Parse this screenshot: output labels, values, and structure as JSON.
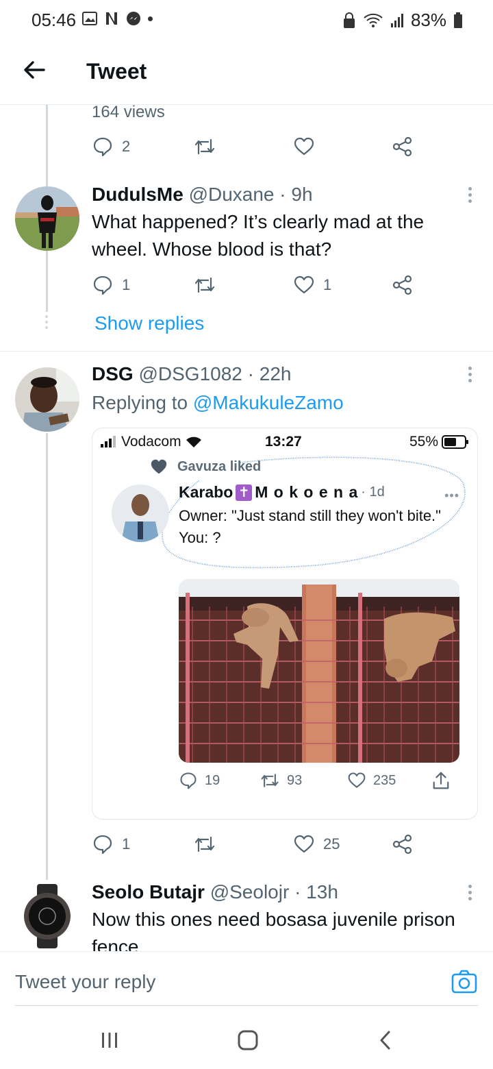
{
  "status_bar": {
    "time": "05:46",
    "battery": "83%"
  },
  "header": {
    "title": "Tweet"
  },
  "top_tweet": {
    "views": "164 views",
    "replies": "2"
  },
  "reply1": {
    "name": "DudulsMe",
    "handle": "@Duxane · 9h",
    "text": "What happened? It’s clearly mad at the wheel. Whose blood is that?",
    "replies": "1",
    "likes": "1",
    "show_replies": "Show replies"
  },
  "reply2": {
    "name": "DSG",
    "handle": "@DSG1082 · 22h",
    "replying_prefix": "Replying to",
    "replying_mention": "@MakukuleZamo",
    "replies": "1",
    "likes": "25",
    "embed": {
      "carrier": "Vodacom",
      "time": "13:27",
      "battery": "55%",
      "liked_by": "Gavuza liked",
      "author_first": "Karabo",
      "author_last": "M o k o e n a",
      "author_time": "· 1d",
      "line1": "Owner: \"Just stand still they won't bite.\"",
      "line2": "You: ?",
      "replies": "19",
      "retweets": "93",
      "likes": "235"
    }
  },
  "reply3": {
    "name": "Seolo Butajr",
    "handle": "@Seolojr · 13h",
    "text": "Now this ones need bosasa juvenile prison fence"
  },
  "reply_bar": {
    "placeholder": "Tweet your reply"
  },
  "colors": {
    "accent": "#1d9bf0",
    "muted": "#536471",
    "thread": "#cfd9de"
  }
}
